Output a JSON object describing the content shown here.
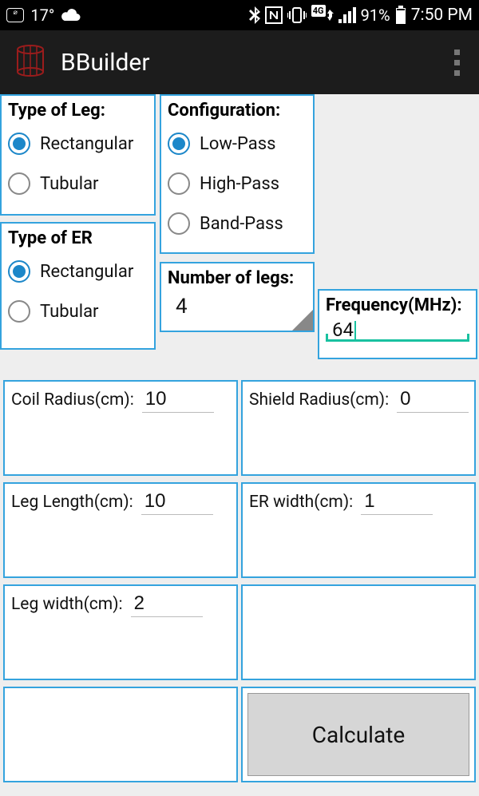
{
  "status": {
    "temp": "17°",
    "battery_pct": "91%",
    "clock": "7:50 PM"
  },
  "app": {
    "title": "BBuilder"
  },
  "cards": {
    "leg_type": {
      "title": "Type of Leg:",
      "options": [
        "Rectangular",
        "Tubular"
      ],
      "selected": 0
    },
    "er_type": {
      "title": "Type of ER",
      "options": [
        "Rectangular",
        "Tubular"
      ],
      "selected": 0
    },
    "config": {
      "title": "Configuration:",
      "options": [
        "Low-Pass",
        "High-Pass",
        "Band-Pass"
      ],
      "selected": 0
    },
    "num_legs": {
      "title": "Number of legs:",
      "value": "4"
    },
    "freq": {
      "title": "Frequency(MHz):",
      "value": "64"
    },
    "coil_radius": {
      "label": "Coil Radius(cm):",
      "value": "10"
    },
    "shield_radius": {
      "label": "Shield Radius(cm):",
      "value": "0"
    },
    "leg_length": {
      "label": "Leg Length(cm):",
      "value": "10"
    },
    "er_width": {
      "label": "ER width(cm):",
      "value": "1"
    },
    "leg_width": {
      "label": "Leg width(cm):",
      "value": "2"
    }
  },
  "calculate_label": "Calculate"
}
